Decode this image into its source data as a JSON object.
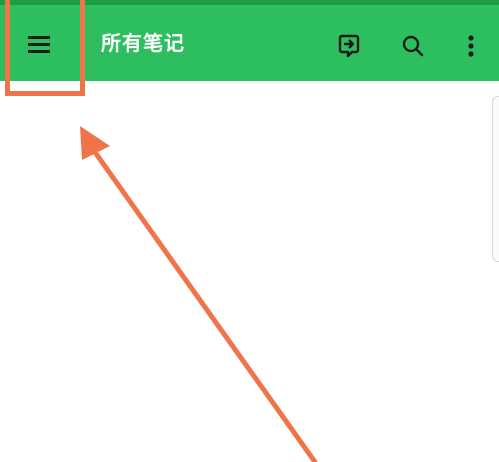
{
  "app_bar": {
    "title": "所有笔记",
    "background_color": "#2dbe60",
    "status_strip_color": "#1e9e43",
    "icons": {
      "menu": "hamburger-menu-icon",
      "sync": "sync-icon",
      "search": "search-icon",
      "more": "more-vert-icon"
    }
  },
  "annotation": {
    "color": "#f0744a"
  }
}
